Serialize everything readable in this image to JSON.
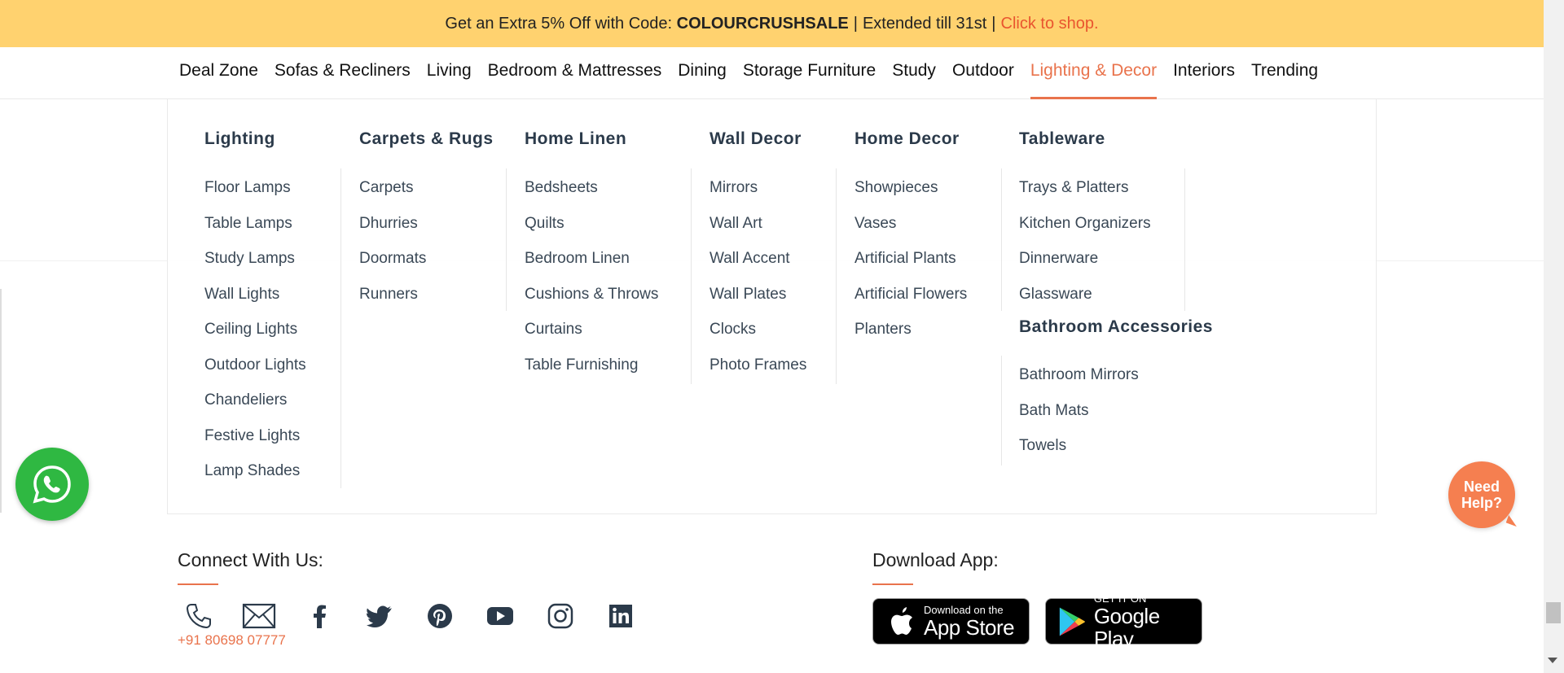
{
  "promo": {
    "text_before": "Get an Extra 5% Off with Code:",
    "code": "COLOURCRUSHSALE",
    "text_after": "Extended till 31st",
    "cta": "Click to shop."
  },
  "nav": {
    "items": [
      {
        "label": "Deal Zone"
      },
      {
        "label": "Sofas & Recliners"
      },
      {
        "label": "Living"
      },
      {
        "label": "Bedroom & Mattresses"
      },
      {
        "label": "Dining"
      },
      {
        "label": "Storage Furniture"
      },
      {
        "label": "Study"
      },
      {
        "label": "Outdoor"
      },
      {
        "label": "Lighting & Decor"
      },
      {
        "label": "Interiors"
      },
      {
        "label": "Trending"
      }
    ],
    "active": "Lighting & Decor"
  },
  "mega_menu": {
    "lighting": {
      "title": "Lighting",
      "items": [
        "Floor Lamps",
        "Table Lamps",
        "Study Lamps",
        "Wall Lights",
        "Ceiling Lights",
        "Outdoor Lights",
        "Chandeliers",
        "Festive Lights",
        "Lamp Shades"
      ]
    },
    "carpets": {
      "title": "Carpets & Rugs",
      "items": [
        "Carpets",
        "Dhurries",
        "Doormats",
        "Runners"
      ]
    },
    "linen": {
      "title": "Home Linen",
      "items": [
        "Bedsheets",
        "Quilts",
        "Bedroom Linen",
        "Cushions & Throws",
        "Curtains",
        "Table Furnishing"
      ]
    },
    "wall_decor": {
      "title": "Wall Decor",
      "items": [
        "Mirrors",
        "Wall Art",
        "Wall Accent",
        "Wall Plates",
        "Clocks",
        "Photo Frames"
      ]
    },
    "home_decor": {
      "title": "Home Decor",
      "items": [
        "Showpieces",
        "Vases",
        "Artificial Plants",
        "Artificial Flowers",
        "Planters"
      ]
    },
    "tableware": {
      "title": "Tableware",
      "items": [
        "Trays & Platters",
        "Kitchen Organizers",
        "Dinnerware",
        "Glassware"
      ]
    },
    "bathroom": {
      "title": "Bathroom Accessories",
      "items": [
        "Bathroom Mirrors",
        "Bath Mats",
        "Towels"
      ]
    }
  },
  "help": {
    "label_line1": "Need",
    "label_line2": "Help?"
  },
  "footer": {
    "connect_title": "Connect With Us:",
    "phone": "+91 80698 07777",
    "social_icons": [
      "phone-icon",
      "email-icon",
      "facebook-icon",
      "twitter-icon",
      "pinterest-icon",
      "youtube-icon",
      "instagram-icon",
      "linkedin-icon"
    ],
    "download_title": "Download App:",
    "app_store": {
      "small": "Download on the",
      "big": "App Store"
    },
    "google_play": {
      "small": "GET IT ON",
      "big": "Google Play"
    }
  },
  "colors": {
    "accent": "#e9734c",
    "promo_bg": "#ffd26f",
    "heading": "#2b3a4a",
    "whatsapp": "#2fb842",
    "help_bubble": "#f57f50"
  }
}
